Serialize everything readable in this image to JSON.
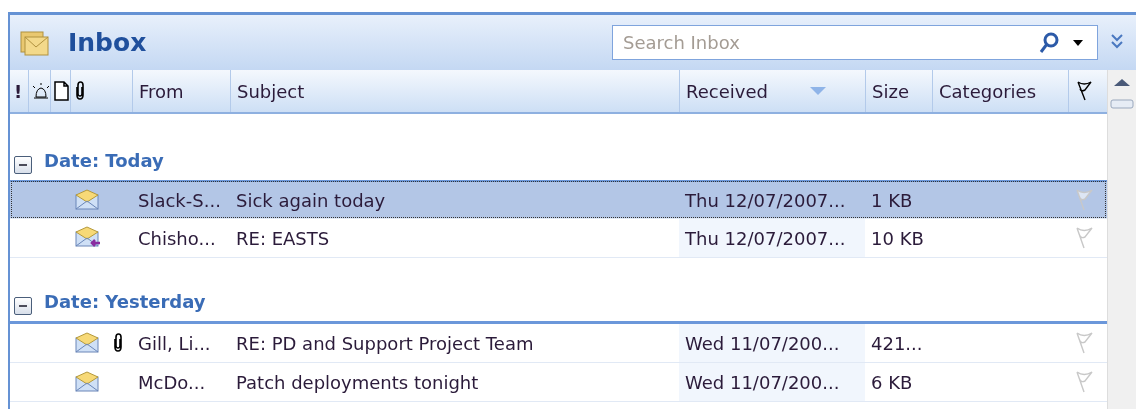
{
  "window": {
    "title": "Inbox"
  },
  "search": {
    "placeholder": "Search Inbox"
  },
  "columns": [
    {
      "kind": "importance",
      "label": "!"
    },
    {
      "kind": "reminder"
    },
    {
      "kind": "icon"
    },
    {
      "kind": "attachment"
    },
    {
      "kind": "text",
      "label": "From"
    },
    {
      "kind": "text",
      "label": "Subject"
    },
    {
      "kind": "text",
      "label": "Received",
      "sorted": true
    },
    {
      "kind": "text",
      "label": "Size"
    },
    {
      "kind": "text",
      "label": "Categories"
    },
    {
      "kind": "flag"
    }
  ],
  "groups": [
    {
      "label": "Date: Today",
      "expanded": true,
      "rows": [
        {
          "kind": "read",
          "attachment": false,
          "selected": true,
          "from": "Slack-S...",
          "subject": "Sick again today",
          "received": "Thu 12/07/2007...",
          "size": "1 KB"
        },
        {
          "kind": "replied",
          "attachment": false,
          "selected": false,
          "from": "Chisho...",
          "subject": "RE: EASTS",
          "received": "Thu 12/07/2007...",
          "size": "10 KB"
        }
      ]
    },
    {
      "label": "Date: Yesterday",
      "expanded": true,
      "rows": [
        {
          "kind": "read",
          "attachment": true,
          "selected": false,
          "from": "Gill, Li...",
          "subject": "RE: PD and Support Project Team",
          "received": "Wed 11/07/200...",
          "size": "421..."
        },
        {
          "kind": "read",
          "attachment": false,
          "selected": false,
          "from": "McDo...",
          "subject": "Patch deployments tonight",
          "received": "Wed 11/07/200...",
          "size": "6 KB"
        }
      ]
    }
  ]
}
